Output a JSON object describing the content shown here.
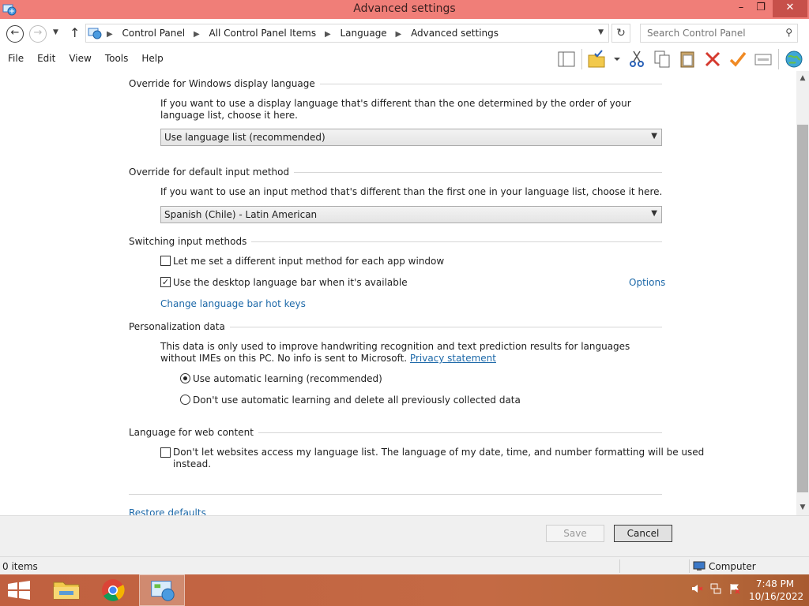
{
  "window": {
    "title": "Advanced settings",
    "controls": {
      "minimize": "–",
      "maximize": "❐",
      "close": "✕"
    }
  },
  "address": {
    "breadcrumbs": [
      "Control Panel",
      "All Control Panel Items",
      "Language",
      "Advanced settings"
    ],
    "search_placeholder": "Search Control Panel"
  },
  "menu": [
    "File",
    "Edit",
    "View",
    "Tools",
    "Help"
  ],
  "toolbar_icons": [
    "layout-icon",
    "folder-check-icon",
    "cut-icon",
    "copy-icon",
    "paste-icon",
    "delete-icon",
    "check-icon",
    "properties-icon",
    "globe-icon"
  ],
  "sections": {
    "display_language": {
      "heading": "Override for Windows display language",
      "description": "If you want to use a display language that's different than the one determined by the order of your language list, choose it here.",
      "selected": "Use language list (recommended)"
    },
    "input_method": {
      "heading": "Override for default input method",
      "description": "If you want to use an input method that's different than the first one in your language list, choose it here.",
      "selected": "Spanish (Chile) - Latin American"
    },
    "switching": {
      "heading": "Switching input methods",
      "per_app_label": "Let me set a different input method for each app window",
      "per_app_checked": false,
      "language_bar_label": "Use the desktop language bar when it's available",
      "language_bar_checked": true,
      "options_link": "Options",
      "hotkeys_link": "Change language bar hot keys"
    },
    "personalization": {
      "heading": "Personalization data",
      "description": "This data is only used to improve handwriting recognition and text prediction results for languages without IMEs on this PC. No info is sent to Microsoft.",
      "privacy_link": "Privacy statement",
      "radio_auto": "Use automatic learning (recommended)",
      "radio_no_auto": "Don't use automatic learning and delete all previously collected data",
      "selected": "auto"
    },
    "web": {
      "heading": "Language for web content",
      "checkbox_label_line1": "Don't let websites access my language list. The language of my date, time, and number formatting will be used",
      "checkbox_label_line2": "instead.",
      "checked": false
    },
    "restore_link": "Restore defaults"
  },
  "buttons": {
    "save": "Save",
    "cancel": "Cancel"
  },
  "status": {
    "items": "0 items",
    "location": "Computer"
  },
  "taskbar": {
    "time": "7:48 PM",
    "date": "10/16/2022"
  },
  "colors": {
    "titlebar": "#f07e78",
    "close": "#c7504a",
    "link": "#1c68a8",
    "taskbar": "#c06040"
  }
}
